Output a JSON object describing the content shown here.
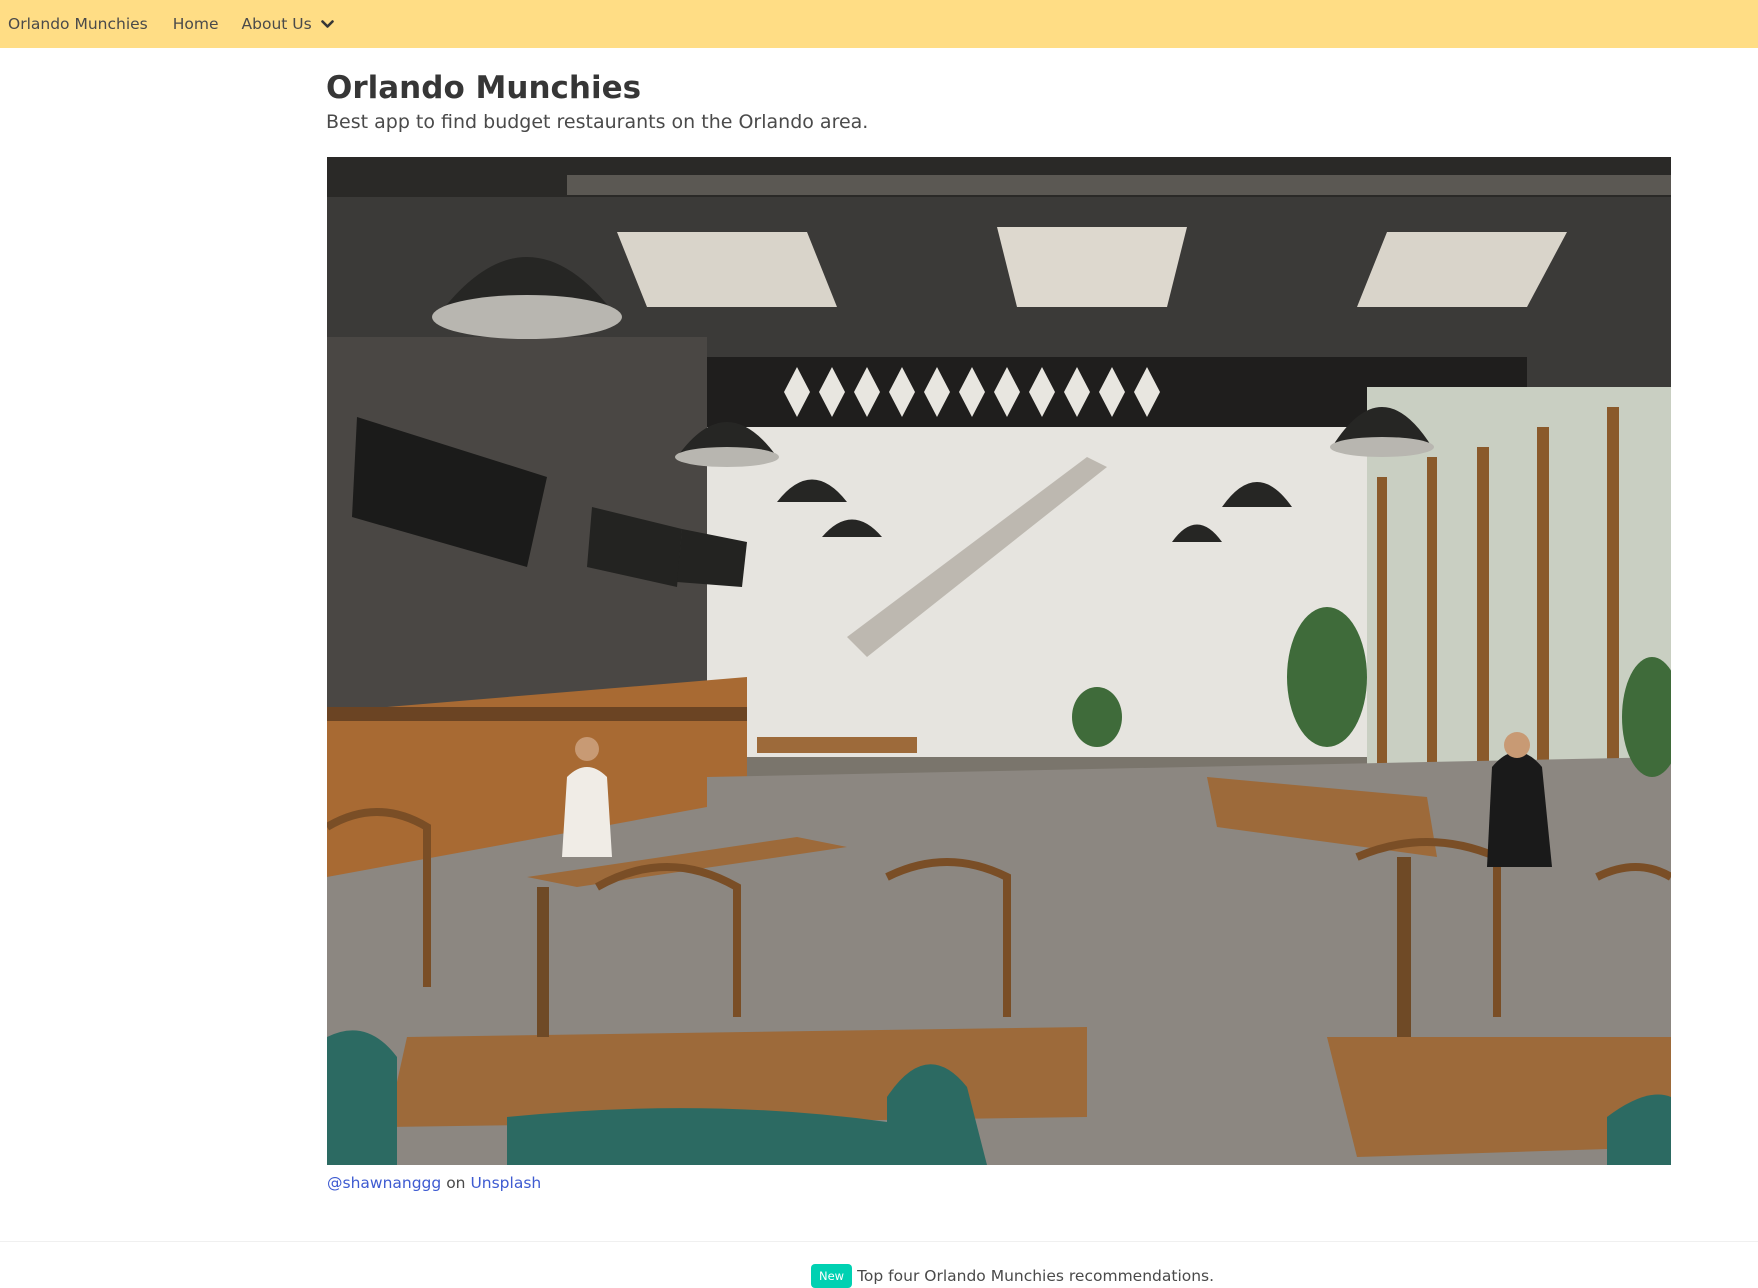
{
  "navbar": {
    "brand": "Orlando Munchies",
    "home": "Home",
    "about": "About Us",
    "background": "#ffdd85"
  },
  "hero": {
    "title": "Orlando Munchies",
    "subtitle": "Best app to find budget restaurants on the Orlando area."
  },
  "photo": {
    "alt": "Restaurant interior with wooden tables and hanging lamps"
  },
  "credit": {
    "author": "@shawnanggg",
    "joiner": "on",
    "site": "Unsplash",
    "link_color": "#3e5bd1"
  },
  "footer": {
    "tag": "New",
    "tag_color": "#00d1b2",
    "text": "Top four Orlando Munchies recommendations."
  },
  "icons": {
    "about_chevron": "chevron-down-icon"
  }
}
